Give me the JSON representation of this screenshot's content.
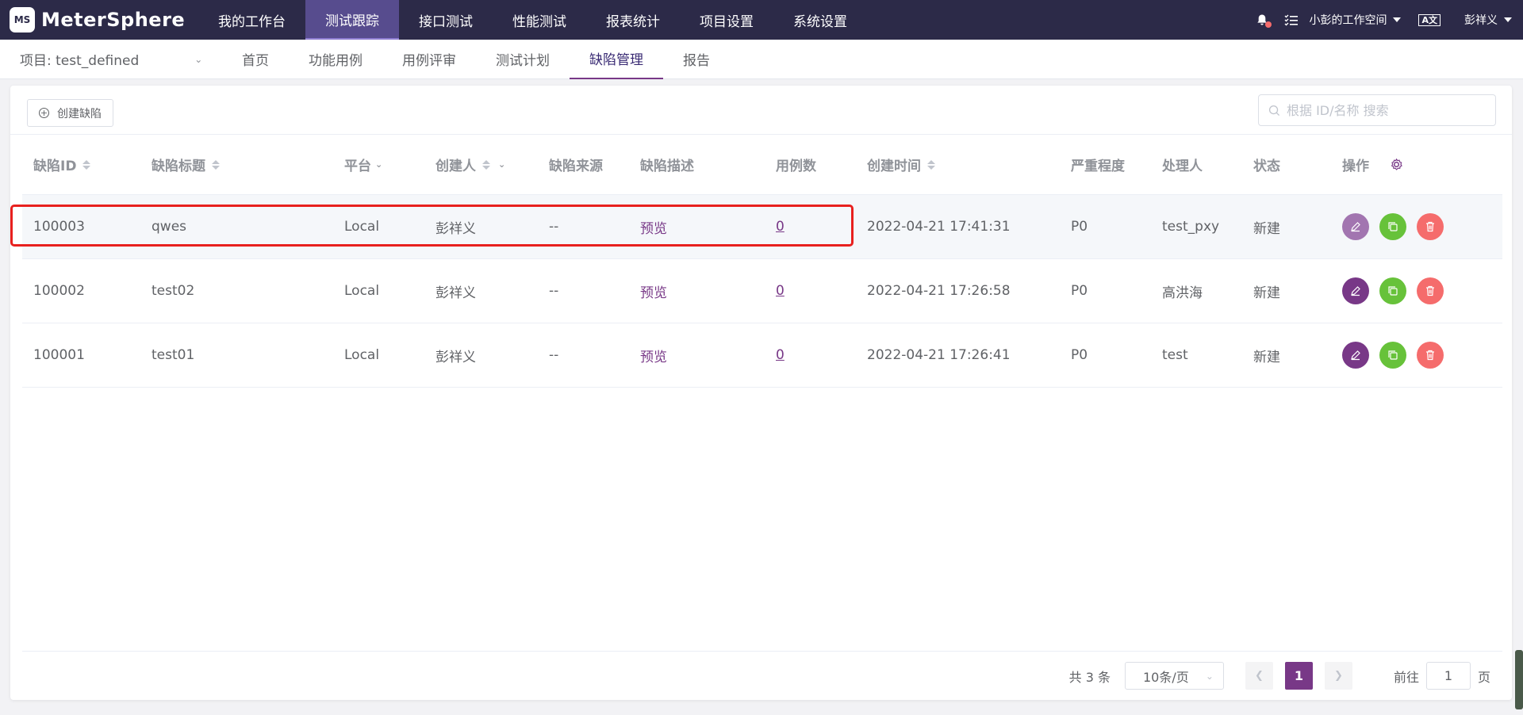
{
  "app": {
    "logo_mark": "MS",
    "logo_text": "MeterSphere"
  },
  "main_nav": [
    "我的工作台",
    "测试跟踪",
    "接口测试",
    "性能测试",
    "报表统计",
    "项目设置",
    "系统设置"
  ],
  "header_right": {
    "workspace": "小彭的工作空间",
    "lang_icon": "A文",
    "user": "彭祥义"
  },
  "project_select": "项目: test_defined",
  "sub_nav": [
    "首页",
    "功能用例",
    "用例评审",
    "测试计划",
    "缺陷管理",
    "报告"
  ],
  "toolbar": {
    "create_label": "创建缺陷",
    "search_placeholder": "根据 ID/名称 搜索"
  },
  "columns": [
    "缺陷ID",
    "缺陷标题",
    "平台",
    "创建人",
    "缺陷来源",
    "缺陷描述",
    "用例数",
    "创建时间",
    "严重程度",
    "处理人",
    "状态",
    "操作"
  ],
  "rows": [
    {
      "id": "100003",
      "title": "qwes",
      "platform": "Local",
      "creator": "彭祥义",
      "source": "--",
      "desc": "预览",
      "cases": "0",
      "created": "2022-04-21 17:41:31",
      "severity": "P0",
      "handler": "test_pxy",
      "status": "新建"
    },
    {
      "id": "100002",
      "title": "test02",
      "platform": "Local",
      "creator": "彭祥义",
      "source": "--",
      "desc": "预览",
      "cases": "0",
      "created": "2022-04-21 17:26:58",
      "severity": "P0",
      "handler": "高洪海",
      "status": "新建"
    },
    {
      "id": "100001",
      "title": "test01",
      "platform": "Local",
      "creator": "彭祥义",
      "source": "--",
      "desc": "预览",
      "cases": "0",
      "created": "2022-04-21 17:26:41",
      "severity": "P0",
      "handler": "test",
      "status": "新建"
    }
  ],
  "pagination": {
    "total": "共 3 条",
    "page_size": "10条/页",
    "current_page": "1",
    "goto_label": "前往",
    "goto_value": "1",
    "page_unit": "页"
  },
  "colors": {
    "header_bg": "#2c2a48",
    "brand": "#783887",
    "success": "#67c23a",
    "danger": "#f56c6c",
    "highlight": "#e8201e"
  }
}
